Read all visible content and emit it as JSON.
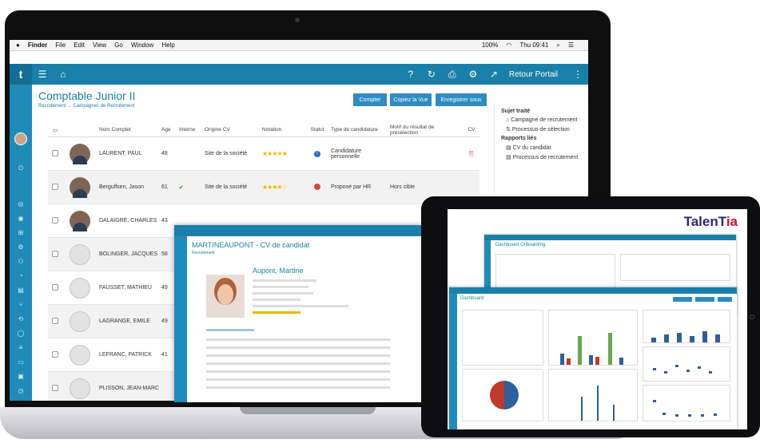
{
  "menubar": {
    "apple": "",
    "app": "Finder",
    "items": [
      "File",
      "Edit",
      "View",
      "Go",
      "Window",
      "Help"
    ],
    "battery": "100%",
    "clock": "Thu 09:41"
  },
  "topbar": {
    "logo": "t",
    "retour": "Retour Portail"
  },
  "page": {
    "title": "Comptable Junior II",
    "breadcrumb": "Recrutement → Campagnes de Recrutement",
    "buttons": [
      "Compter",
      "Copiez la Vue",
      "Enregistrer sous"
    ]
  },
  "table": {
    "headers": [
      "",
      "",
      "Nom Complet",
      "Age",
      "Interne",
      "Origine CV",
      "Notation",
      "Statut",
      "Type de candidature",
      "Motif du résultat de présélection",
      "CV"
    ],
    "rows": [
      {
        "name": "LAURENT, PAUL",
        "age": "48",
        "interne": "",
        "origine": "Site de la société",
        "stars": "★★★★★",
        "type": "Candidature personnelle",
        "motif": "",
        "cv": "pdf",
        "photo": true,
        "status": "info"
      },
      {
        "name": "Bergulfsen, Jason",
        "age": "61",
        "interne": "✔",
        "origine": "Site de la société",
        "stars": "★★★★☆",
        "type": "Proposé par HR",
        "motif": "Hors cible",
        "cv": "",
        "photo": true,
        "status": "stop"
      },
      {
        "name": "DALAIGRE, CHARLES",
        "age": "43",
        "interne": "",
        "origine": "",
        "stars": "",
        "type": "",
        "motif": "",
        "cv": "",
        "photo": true,
        "status": ""
      },
      {
        "name": "BOLINGER, JACQUES",
        "age": "58",
        "interne": "",
        "origine": "",
        "stars": "",
        "type": "",
        "motif": "",
        "cv": "",
        "photo": false,
        "status": ""
      },
      {
        "name": "FAUSSET, MATHIEU",
        "age": "49",
        "interne": "",
        "origine": "",
        "stars": "",
        "type": "",
        "motif": "",
        "cv": "",
        "photo": false,
        "status": ""
      },
      {
        "name": "LAGRANGE, EMILE",
        "age": "49",
        "interne": "",
        "origine": "",
        "stars": "",
        "type": "",
        "motif": "",
        "cv": "",
        "photo": false,
        "status": ""
      },
      {
        "name": "LEFRANC, PATRICK",
        "age": "41",
        "interne": "",
        "origine": "",
        "stars": "",
        "type": "",
        "motif": "",
        "cv": "",
        "photo": false,
        "status": ""
      },
      {
        "name": "PLISSON, JEAN-MARC",
        "age": "",
        "interne": "",
        "origine": "",
        "stars": "",
        "type": "",
        "motif": "",
        "cv": "",
        "photo": false,
        "status": ""
      }
    ]
  },
  "sidepanel": {
    "sujet": "Sujet traité",
    "campagne": "Campagne de recrutement",
    "processus": "Processus de sélection",
    "rapports": "Rapports liés",
    "cv": "CV du candidat",
    "processus_rec": "Processus de recrutement"
  },
  "modal": {
    "title": "MARTINEAUPONT - CV de candidat",
    "subtitle": "Recrutement",
    "name": "Aupont, Martine"
  },
  "tablet": {
    "brand_a": "TalenT",
    "brand_b": "ia",
    "dash1_title": "Dashboard Onboarding",
    "dash2_title": "Dashboard"
  },
  "colors": {
    "primary": "#1a7fa9",
    "rail": "#1f8bbb",
    "button": "#2d8cc2",
    "star": "#f0b400"
  }
}
